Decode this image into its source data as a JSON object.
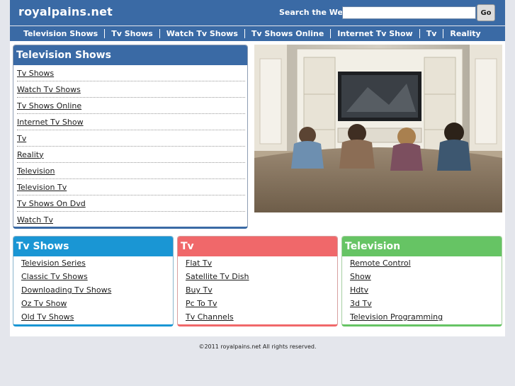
{
  "header": {
    "site_title": "royalpains.net",
    "search_label": "Search the Web:",
    "search_value": "",
    "go_label": "Go"
  },
  "nav": {
    "items": [
      "Television Shows",
      "Tv Shows",
      "Watch Tv Shows",
      "Tv Shows Online",
      "Internet Tv Show",
      "Tv",
      "Reality"
    ]
  },
  "main_box": {
    "title": "Television Shows",
    "links": [
      "Tv Shows",
      "Watch Tv Shows",
      "Tv Shows Online",
      "Internet Tv Show",
      "Tv",
      "Reality",
      "Television",
      "Television Tv",
      "Tv Shows On Dvd",
      "Watch Tv"
    ]
  },
  "categories": [
    {
      "title": "Tv Shows",
      "links": [
        "Television Series",
        "Classic Tv Shows",
        "Downloading Tv Shows",
        "Oz Tv Show",
        "Old Tv Shows"
      ]
    },
    {
      "title": "Tv",
      "links": [
        "Flat Tv",
        "Satellite Tv Dish",
        "Buy Tv",
        "Pc To Tv",
        "Tv Channels"
      ]
    },
    {
      "title": "Television",
      "links": [
        "Remote Control",
        "Show",
        "Hdtv",
        "3d Tv",
        "Television Programming"
      ]
    }
  ],
  "footer": {
    "copyright": "©2011 royalpains.net All rights reserved."
  },
  "colors": {
    "primary": "#3a6aa5",
    "tvshows": "#1a96d4",
    "tv": "#f0686a",
    "television": "#66c464",
    "page_bg": "#e4e6ec"
  }
}
